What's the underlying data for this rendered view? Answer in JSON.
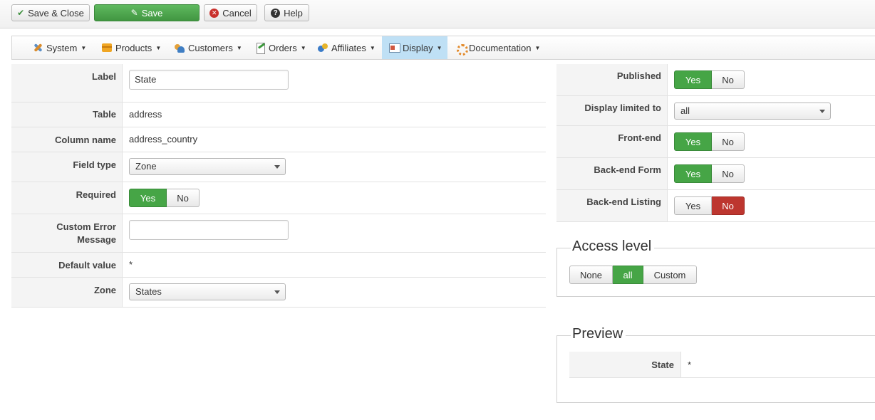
{
  "toolbar": {
    "save_close": "Save & Close",
    "save": "Save",
    "cancel": "Cancel",
    "help": "Help"
  },
  "menu": {
    "items": [
      {
        "label": "System",
        "icon": "system-icon"
      },
      {
        "label": "Products",
        "icon": "products-icon"
      },
      {
        "label": "Customers",
        "icon": "customers-icon"
      },
      {
        "label": "Orders",
        "icon": "orders-icon"
      },
      {
        "label": "Affiliates",
        "icon": "affiliates-icon"
      },
      {
        "label": "Display",
        "icon": "display-icon",
        "active": true
      },
      {
        "label": "Documentation",
        "icon": "documentation-icon"
      }
    ]
  },
  "form": {
    "label": {
      "label": "Label",
      "value": "State"
    },
    "table": {
      "label": "Table",
      "value": "address"
    },
    "column_name": {
      "label": "Column name",
      "value": "address_country"
    },
    "field_type": {
      "label": "Field type",
      "value": "Zone"
    },
    "required": {
      "label": "Required",
      "yes": "Yes",
      "no": "No",
      "selected": "Yes"
    },
    "custom_error": {
      "label_line1": "Custom Error",
      "label_line2": "Message",
      "value": ""
    },
    "default_value": {
      "label": "Default value",
      "value": "*"
    },
    "zone": {
      "label": "Zone",
      "value": "States"
    }
  },
  "options": {
    "published": {
      "label": "Published",
      "yes": "Yes",
      "no": "No",
      "selected": "Yes"
    },
    "display_limited": {
      "label": "Display limited to",
      "value": "all"
    },
    "front_end": {
      "label": "Front-end",
      "yes": "Yes",
      "no": "No",
      "selected": "Yes"
    },
    "backend_form": {
      "label": "Back-end Form",
      "yes": "Yes",
      "no": "No",
      "selected": "Yes"
    },
    "backend_listing": {
      "label": "Back-end Listing",
      "yes": "Yes",
      "no": "No",
      "selected": "No"
    }
  },
  "access_level": {
    "title": "Access level",
    "options": [
      "None",
      "all",
      "Custom"
    ],
    "selected": "all"
  },
  "preview": {
    "title": "Preview",
    "label": "State",
    "value": "*"
  },
  "colors": {
    "green": "#46a546",
    "red": "#bd362f",
    "active_menu": "#bfe0f5"
  }
}
